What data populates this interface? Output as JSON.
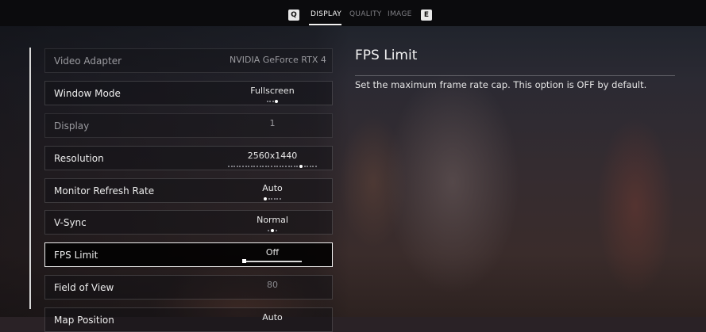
{
  "tabs": {
    "prev_key": "Q",
    "next_key": "E",
    "items": [
      "DISPLAY",
      "QUALITY",
      "IMAGE"
    ]
  },
  "settings": [
    {
      "label": "Video Adapter",
      "value": "NVIDIA GeForce RTX 4"
    },
    {
      "label": "Window Mode",
      "value": "Fullscreen"
    },
    {
      "label": "Display",
      "value": "1"
    },
    {
      "label": "Resolution",
      "value": "2560x1440"
    },
    {
      "label": "Monitor Refresh Rate",
      "value": "Auto"
    },
    {
      "label": "V-Sync",
      "value": "Normal"
    },
    {
      "label": "FPS Limit",
      "value": "Off"
    },
    {
      "label": "Field of View",
      "value": "80"
    },
    {
      "label": "Map Position",
      "value": "Auto"
    }
  ],
  "info": {
    "title": "FPS Limit",
    "description": "Set the maximum frame rate cap. This option is OFF by default."
  },
  "colors": {
    "accent": "#f2f2f2",
    "panel_bg": "#0b0b0d",
    "inactive_tab": "#7d7d82"
  }
}
